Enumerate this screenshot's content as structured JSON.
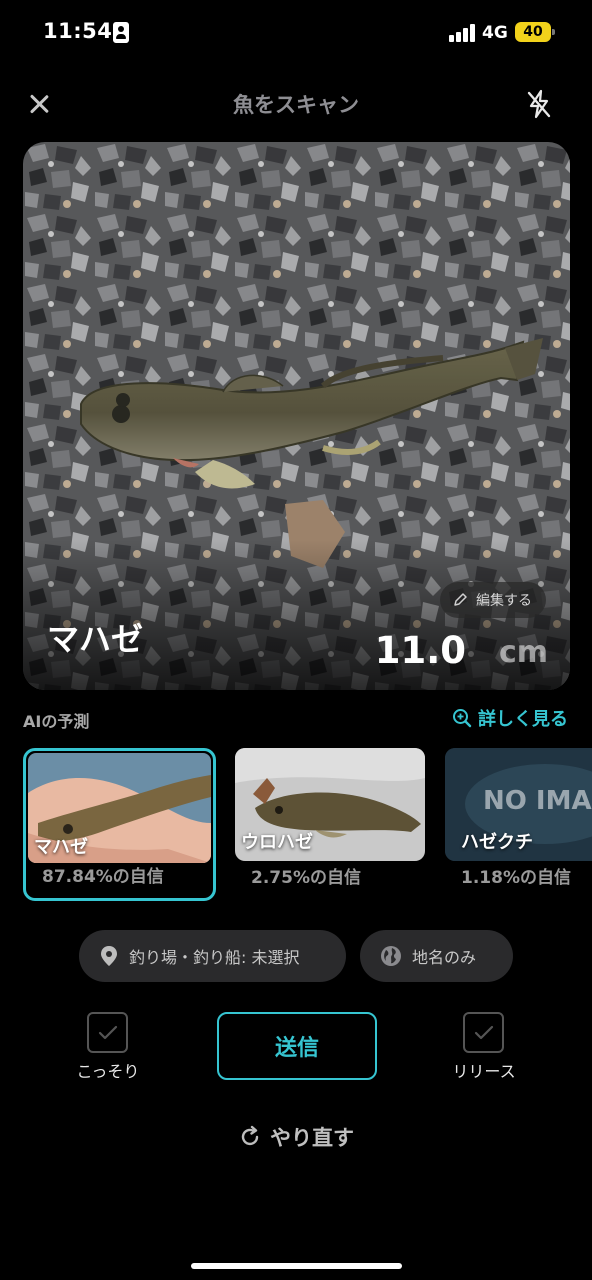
{
  "status_bar": {
    "time": "11:54",
    "network": "4G",
    "battery": "40",
    "battery_color": "#f2d21b",
    "icons": [
      "person-badge-icon",
      "signal-bars-icon",
      "battery-icon"
    ]
  },
  "header": {
    "title": "魚をスキャン",
    "close_icon": "close-icon",
    "flash_icon": "flash-off-icon"
  },
  "photo": {
    "species": "マハゼ",
    "size_value": "11.0",
    "size_unit": "cm",
    "edit_label": "編集する",
    "edit_icon": "pencil-icon"
  },
  "prediction": {
    "title": "AIの予測",
    "detail_link": "詳しく見る",
    "detail_icon": "zoom-icon",
    "selected_index": 0,
    "candidates": [
      {
        "name": "マハゼ",
        "confidence": "87.84%の自信"
      },
      {
        "name": "ウロハゼ",
        "confidence": "2.75%の自信"
      },
      {
        "name": "ハゼクチ",
        "confidence": "1.18%の自信",
        "placeholder_text": "NO IMAGE"
      }
    ]
  },
  "location": {
    "spot_label": "釣り場・釣り船: 未選択",
    "spot_icon": "location-pin-icon",
    "place_label": "地名のみ",
    "place_icon": "globe-icon"
  },
  "actions": {
    "secret_label": "こっそり",
    "send_label": "送信",
    "release_label": "リリース",
    "retry_label": "やり直す",
    "retry_icon": "redo-icon"
  },
  "colors": {
    "accent": "#36c5d1",
    "background": "#000000",
    "pill_background": "#2a2a2c"
  }
}
